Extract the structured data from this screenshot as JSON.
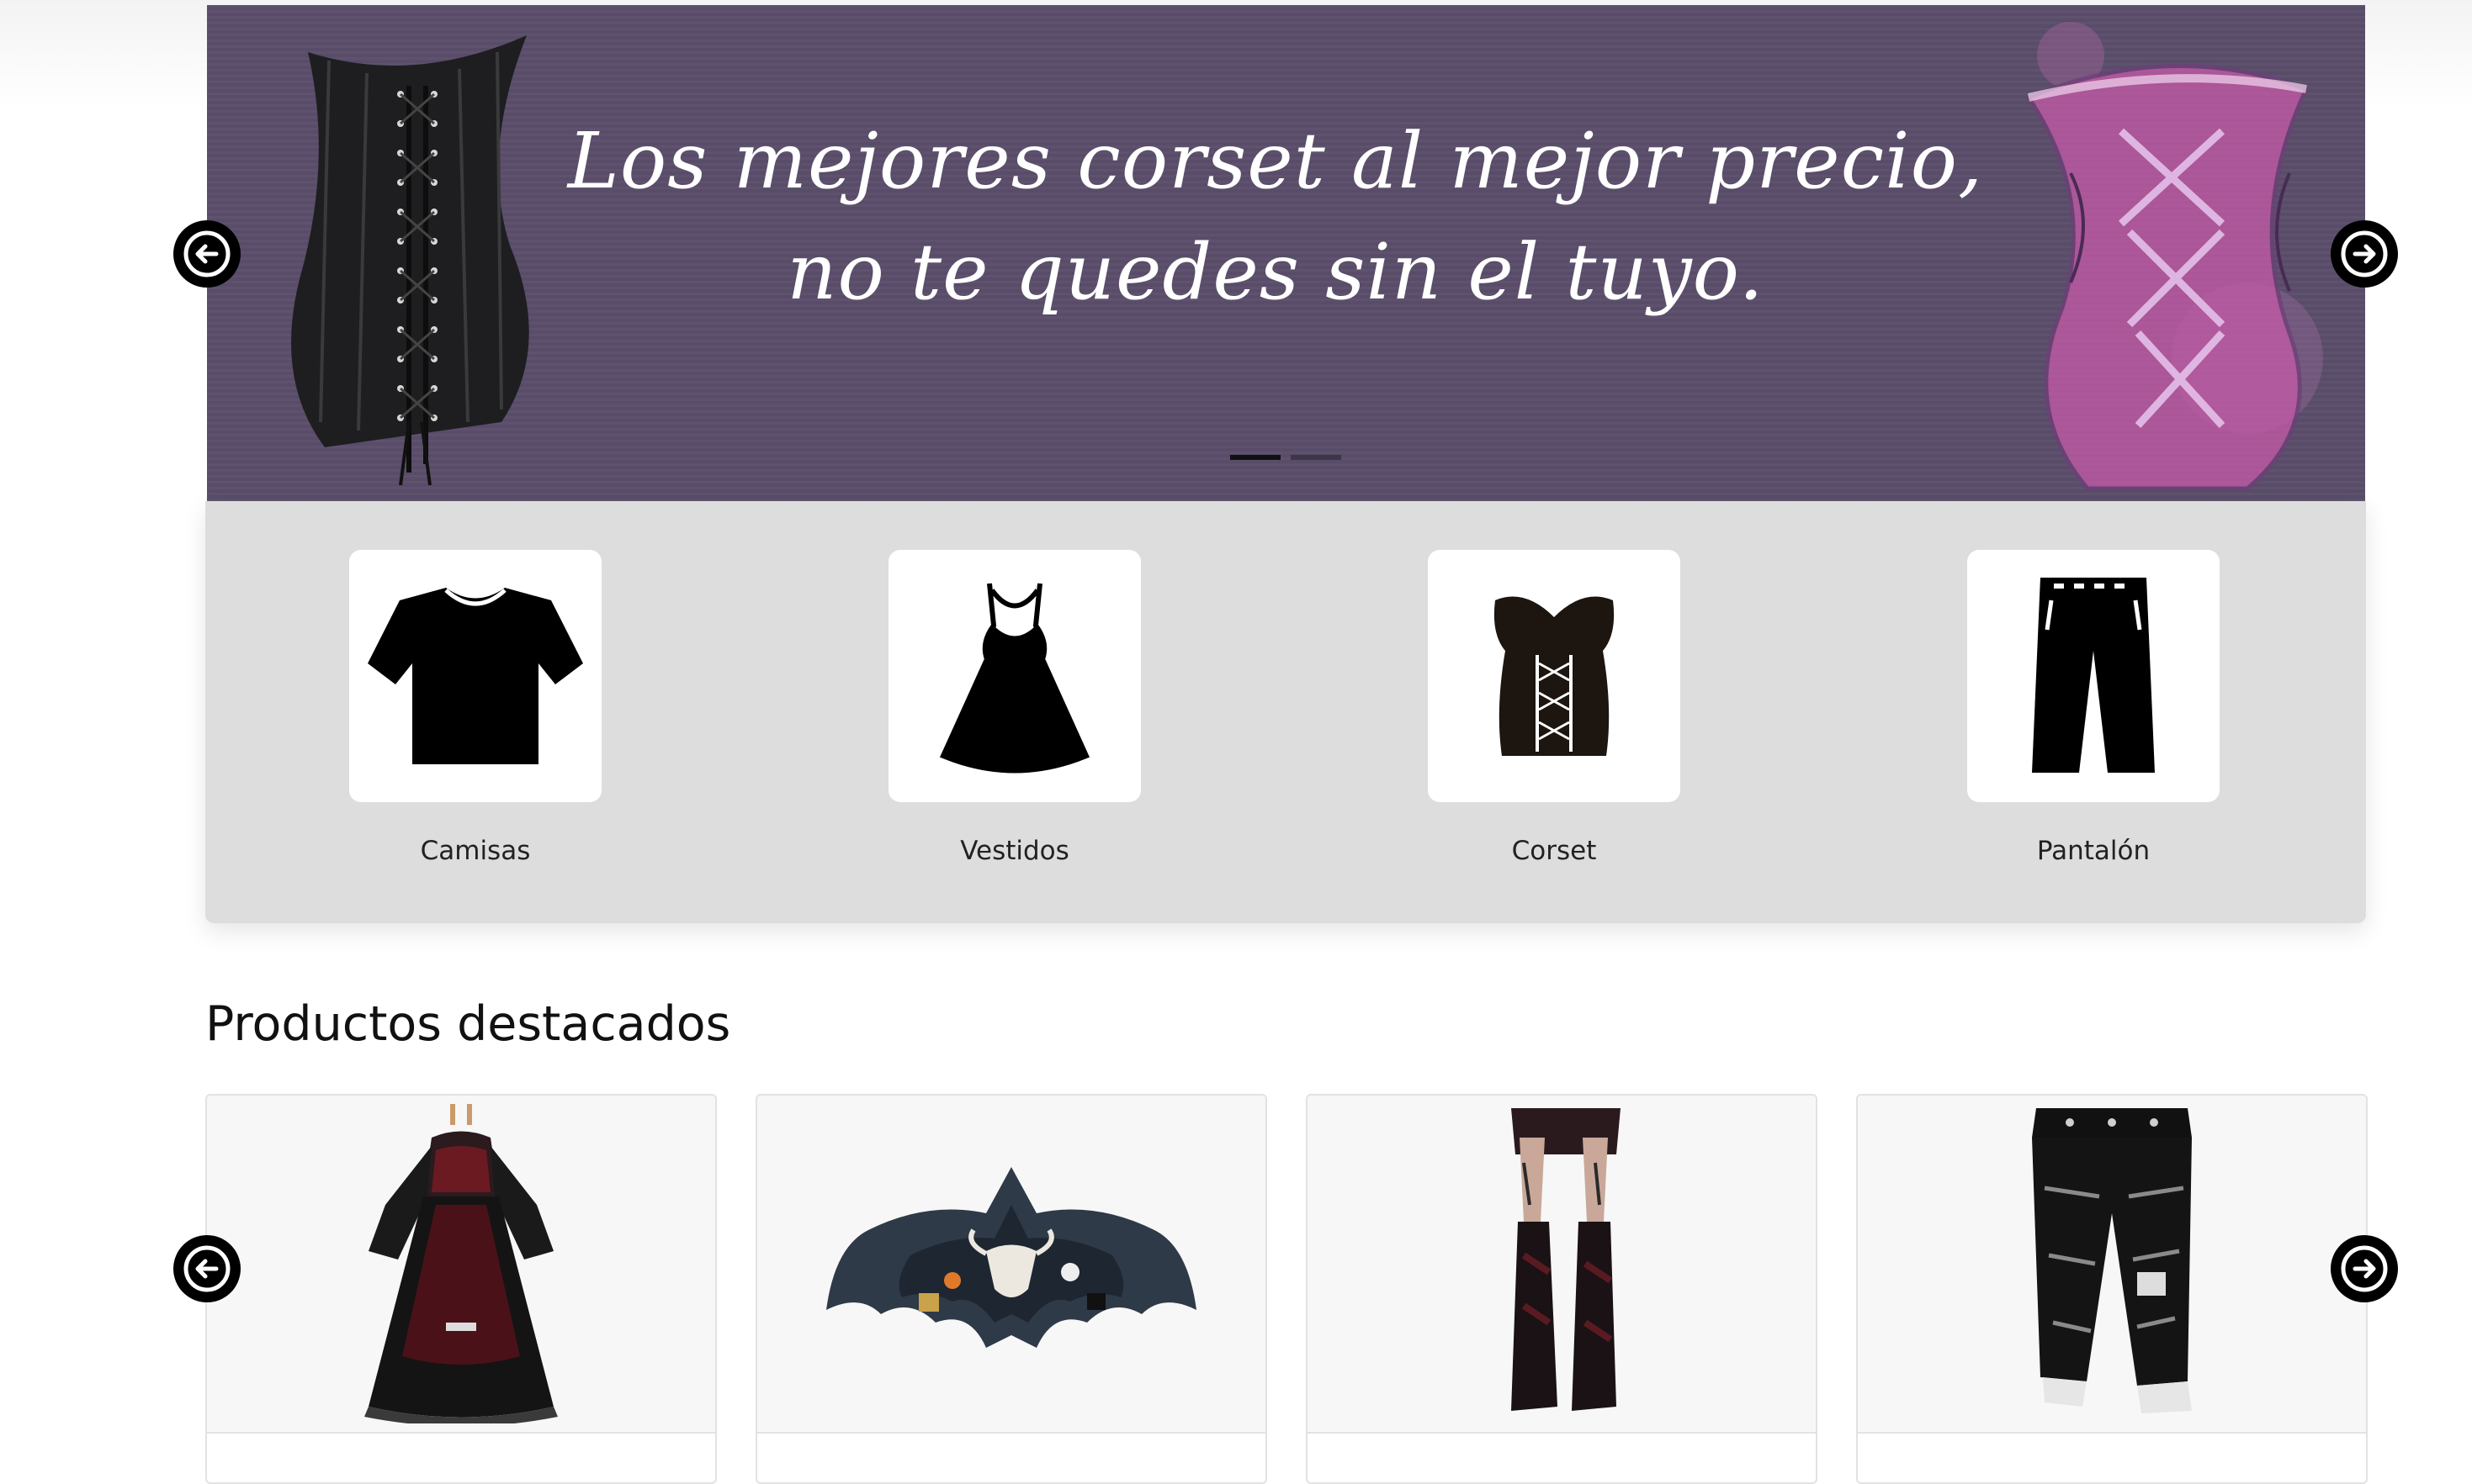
{
  "banner": {
    "slogan": "Los mejores corset al mejor precio, no te quedes sin el tuyo.",
    "slide_count": 2,
    "active_slide": 1
  },
  "categories": [
    {
      "label": "Camisas",
      "icon": "shirt-icon"
    },
    {
      "label": "Vestidos",
      "icon": "dress-icon"
    },
    {
      "label": "Corset",
      "icon": "corset-icon"
    },
    {
      "label": "Pantalón",
      "icon": "pants-icon"
    }
  ],
  "featured": {
    "title": "Productos destacados",
    "products": [
      {
        "image": "gothic-dress-image"
      },
      {
        "image": "bat-shelf-image"
      },
      {
        "image": "gothic-leg-warmers-image"
      },
      {
        "image": "gothic-pants-image"
      }
    ]
  },
  "controls": {
    "prev_icon": "arrow-left-circle-icon",
    "next_icon": "arrow-right-circle-icon"
  },
  "colors": {
    "banner_bg": "#5a4e6a",
    "category_bg": "#dddddd",
    "arrow_bg": "#000000"
  }
}
